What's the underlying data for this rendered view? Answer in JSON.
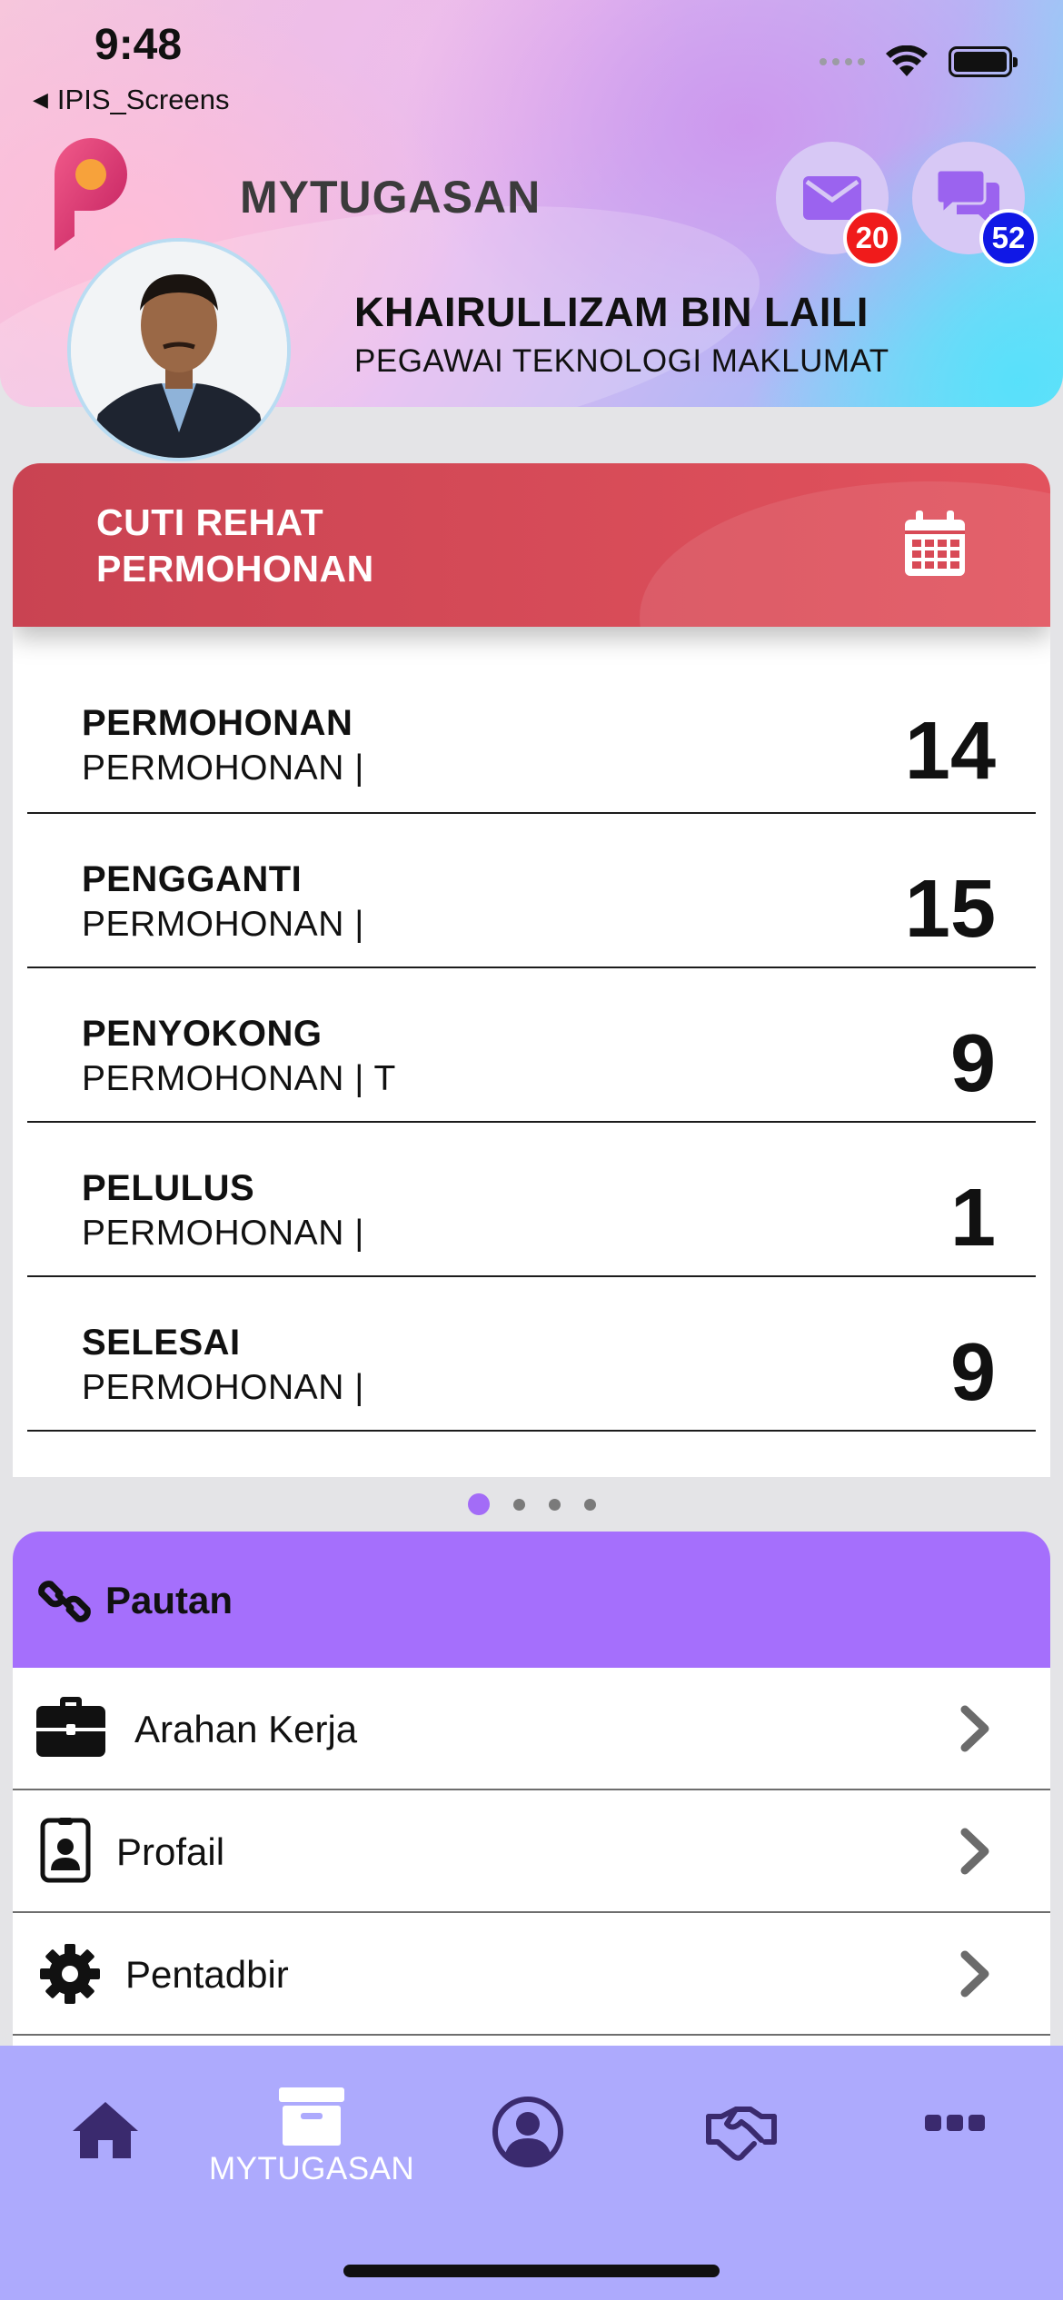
{
  "status_bar": {
    "time": "9:48",
    "back_app": "IPIS_Screens"
  },
  "header": {
    "app_title": "MYTUGASAN",
    "mail_badge": "20",
    "chat_badge": "52",
    "user_name": "KHAIRULLIZAM BIN LAILI",
    "user_role": "PEGAWAI TEKNOLOGI MAKLUMAT",
    "colors": {
      "mail_badge": "#f01b1b",
      "chat_badge": "#1018e6"
    }
  },
  "leave_card": {
    "title_line1": "CUTI REHAT",
    "title_line2": "PERMOHONAN",
    "rows": [
      {
        "label": "PERMOHONAN",
        "sub": "PERMOHONAN |",
        "count": "14"
      },
      {
        "label": "PENGGANTI",
        "sub": "PERMOHONAN |",
        "count": "15"
      },
      {
        "label": "PENYOKONG",
        "sub": "PERMOHONAN | T",
        "count": "9"
      },
      {
        "label": "PELULUS",
        "sub": "PERMOHONAN |",
        "count": "1"
      },
      {
        "label": "SELESAI",
        "sub": "PERMOHONAN |",
        "count": "9"
      }
    ],
    "colors": {
      "header": "#d84a56"
    }
  },
  "pager": {
    "pages": 4,
    "active_index": 0
  },
  "links_card": {
    "title": "Pautan",
    "items": [
      {
        "label": "Arahan Kerja",
        "icon": "briefcase-icon"
      },
      {
        "label": "Profail",
        "icon": "id-badge-icon"
      },
      {
        "label": "Pentadbir",
        "icon": "gear-icon"
      }
    ],
    "colors": {
      "header": "#a56ffc"
    }
  },
  "bottom_nav": {
    "active_label": "MYTUGASAN",
    "items": [
      "home-icon",
      "archive-icon",
      "user-circle-icon",
      "handshake-icon",
      "more-icon"
    ],
    "colors": {
      "background": "#adaafd",
      "icon": "#3a2a6e"
    }
  }
}
